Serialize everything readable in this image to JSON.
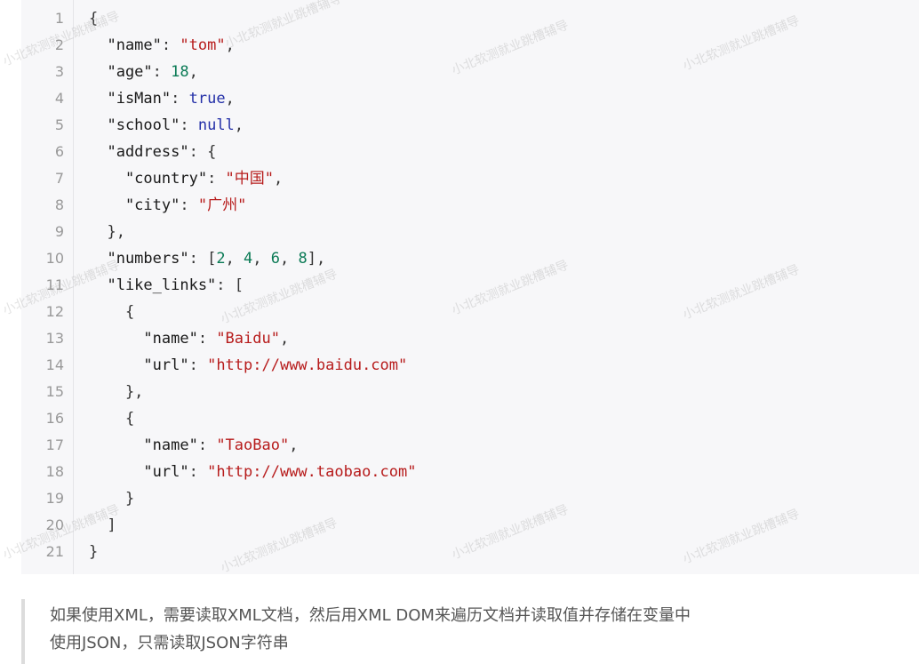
{
  "code": {
    "line_numbers": [
      "1",
      "2",
      "3",
      "4",
      "5",
      "6",
      "7",
      "8",
      "9",
      "10",
      "11",
      "12",
      "13",
      "14",
      "15",
      "16",
      "17",
      "18",
      "19",
      "20",
      "21"
    ],
    "lines": [
      [
        {
          "t": "{",
          "c": "p"
        }
      ],
      [
        {
          "t": "  \"name\"",
          "c": "k"
        },
        {
          "t": ": ",
          "c": "p"
        },
        {
          "t": "\"tom\"",
          "c": "s"
        },
        {
          "t": ",",
          "c": "p"
        }
      ],
      [
        {
          "t": "  \"age\"",
          "c": "k"
        },
        {
          "t": ": ",
          "c": "p"
        },
        {
          "t": "18",
          "c": "n"
        },
        {
          "t": ",",
          "c": "p"
        }
      ],
      [
        {
          "t": "  \"isMan\"",
          "c": "k"
        },
        {
          "t": ": ",
          "c": "p"
        },
        {
          "t": "true",
          "c": "b"
        },
        {
          "t": ",",
          "c": "p"
        }
      ],
      [
        {
          "t": "  \"school\"",
          "c": "k"
        },
        {
          "t": ": ",
          "c": "p"
        },
        {
          "t": "null",
          "c": "b"
        },
        {
          "t": ",",
          "c": "p"
        }
      ],
      [
        {
          "t": "  \"address\"",
          "c": "k"
        },
        {
          "t": ": {",
          "c": "p"
        }
      ],
      [
        {
          "t": "    \"country\"",
          "c": "k"
        },
        {
          "t": ": ",
          "c": "p"
        },
        {
          "t": "\"中国\"",
          "c": "s"
        },
        {
          "t": ",",
          "c": "p"
        }
      ],
      [
        {
          "t": "    \"city\"",
          "c": "k"
        },
        {
          "t": ": ",
          "c": "p"
        },
        {
          "t": "\"广州\"",
          "c": "s"
        }
      ],
      [
        {
          "t": "  },",
          "c": "p"
        }
      ],
      [
        {
          "t": "  \"numbers\"",
          "c": "k"
        },
        {
          "t": ": [",
          "c": "p"
        },
        {
          "t": "2",
          "c": "n"
        },
        {
          "t": ", ",
          "c": "p"
        },
        {
          "t": "4",
          "c": "n"
        },
        {
          "t": ", ",
          "c": "p"
        },
        {
          "t": "6",
          "c": "n"
        },
        {
          "t": ", ",
          "c": "p"
        },
        {
          "t": "8",
          "c": "n"
        },
        {
          "t": "],",
          "c": "p"
        }
      ],
      [
        {
          "t": "  \"like_links\"",
          "c": "k"
        },
        {
          "t": ": [",
          "c": "p"
        }
      ],
      [
        {
          "t": "    {",
          "c": "p"
        }
      ],
      [
        {
          "t": "      \"name\"",
          "c": "k"
        },
        {
          "t": ": ",
          "c": "p"
        },
        {
          "t": "\"Baidu\"",
          "c": "s"
        },
        {
          "t": ",",
          "c": "p"
        }
      ],
      [
        {
          "t": "      \"url\"",
          "c": "k"
        },
        {
          "t": ": ",
          "c": "p"
        },
        {
          "t": "\"http://www.baidu.com\"",
          "c": "s"
        }
      ],
      [
        {
          "t": "    },",
          "c": "p"
        }
      ],
      [
        {
          "t": "    {",
          "c": "p"
        }
      ],
      [
        {
          "t": "      \"name\"",
          "c": "k"
        },
        {
          "t": ": ",
          "c": "p"
        },
        {
          "t": "\"TaoBao\"",
          "c": "s"
        },
        {
          "t": ",",
          "c": "p"
        }
      ],
      [
        {
          "t": "      \"url\"",
          "c": "k"
        },
        {
          "t": ": ",
          "c": "p"
        },
        {
          "t": "\"http://www.taobao.com\"",
          "c": "s"
        }
      ],
      [
        {
          "t": "    }",
          "c": "p"
        }
      ],
      [
        {
          "t": "  ]",
          "c": "p"
        }
      ],
      [
        {
          "t": "}",
          "c": "p"
        }
      ]
    ]
  },
  "watermark": {
    "text": "小北软测就业跳槽辅导"
  },
  "quote": {
    "line1": "如果使用XML，需要读取XML文档，然后用XML DOM来遍历文档并读取值并存储在变量中",
    "line2": "使用JSON，只需读取JSON字符串"
  },
  "colors": {
    "string": "#b71c1c",
    "number": "#0a7a55",
    "keyword": "#2430a8",
    "key": "#1a1a1a"
  }
}
